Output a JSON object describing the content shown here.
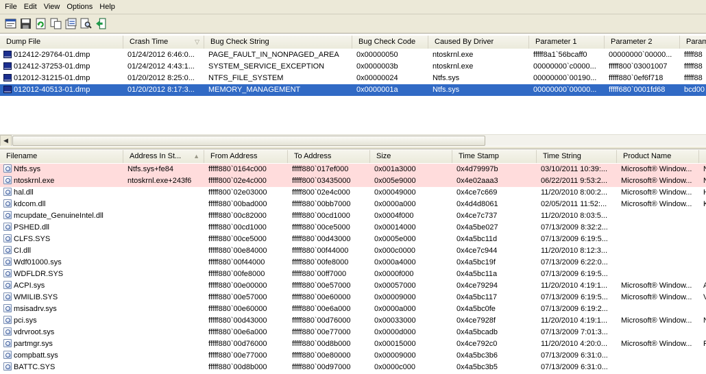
{
  "menu": [
    "File",
    "Edit",
    "View",
    "Options",
    "Help"
  ],
  "toolbar": [
    "properties-icon",
    "save-icon",
    "refresh-icon",
    "copy-icon",
    "report-icon",
    "find-icon",
    "exit-icon"
  ],
  "dumps": {
    "columns": [
      {
        "label": "Dump File"
      },
      {
        "label": "Crash Time",
        "sort": "▽"
      },
      {
        "label": "Bug Check String"
      },
      {
        "label": "Bug Check Code"
      },
      {
        "label": "Caused By Driver"
      },
      {
        "label": "Parameter 1"
      },
      {
        "label": "Parameter 2"
      },
      {
        "label": "Param"
      }
    ],
    "rows": [
      {
        "c": [
          "012412-29764-01.dmp",
          "01/24/2012 6:46:0...",
          "PAGE_FAULT_IN_NONPAGED_AREA",
          "0x00000050",
          "ntoskrnl.exe",
          "fffff8a1`56bcaff0",
          "00000000`00000...",
          "fffff88"
        ],
        "selected": false
      },
      {
        "c": [
          "012412-37253-01.dmp",
          "01/24/2012 4:43:1...",
          "SYSTEM_SERVICE_EXCEPTION",
          "0x0000003b",
          "ntoskrnl.exe",
          "00000000`c0000...",
          "fffff800`03001007",
          "fffff88"
        ],
        "selected": false
      },
      {
        "c": [
          "012012-31215-01.dmp",
          "01/20/2012 8:25:0...",
          "NTFS_FILE_SYSTEM",
          "0x00000024",
          "Ntfs.sys",
          "00000000`00190...",
          "fffff880`0ef6f718",
          "fffff88"
        ],
        "selected": false
      },
      {
        "c": [
          "012012-40513-01.dmp",
          "01/20/2012 8:17:3...",
          "MEMORY_MANAGEMENT",
          "0x0000001a",
          "Ntfs.sys",
          "00000000`00000...",
          "fffff680`0001fd68",
          "bcd00"
        ],
        "selected": true
      }
    ]
  },
  "modules": {
    "columns": [
      {
        "label": "Filename"
      },
      {
        "label": "Address In St...",
        "sort": "▲"
      },
      {
        "label": "From Address"
      },
      {
        "label": "To Address"
      },
      {
        "label": "Size"
      },
      {
        "label": "Time Stamp"
      },
      {
        "label": "Time String"
      },
      {
        "label": "Product Name"
      },
      {
        "label": ""
      }
    ],
    "rows": [
      {
        "c": [
          "Ntfs.sys",
          "Ntfs.sys+fe84",
          "fffff880`0164c000",
          "fffff880`017ef000",
          "0x001a3000",
          "0x4d79997b",
          "03/10/2011 10:39:...",
          "Microsoft® Window...",
          "N"
        ],
        "highlight": true
      },
      {
        "c": [
          "ntoskrnl.exe",
          "ntoskrnl.exe+243f6",
          "fffff800`02e4c000",
          "fffff800`03435000",
          "0x005e9000",
          "0x4e02aaa3",
          "06/22/2011 9:53:2...",
          "Microsoft® Window...",
          "N"
        ],
        "highlight": true
      },
      {
        "c": [
          "hal.dll",
          "",
          "fffff800`02e03000",
          "fffff800`02e4c000",
          "0x00049000",
          "0x4ce7c669",
          "11/20/2010 8:00:2...",
          "Microsoft® Window...",
          "H"
        ],
        "highlight": false
      },
      {
        "c": [
          "kdcom.dll",
          "",
          "fffff880`00bad000",
          "fffff880`00bb7000",
          "0x0000a000",
          "0x4d4d8061",
          "02/05/2011 11:52:...",
          "Microsoft® Window...",
          "K"
        ],
        "highlight": false
      },
      {
        "c": [
          "mcupdate_GenuineIntel.dll",
          "",
          "fffff880`00c82000",
          "fffff880`00cd1000",
          "0x0004f000",
          "0x4ce7c737",
          "11/20/2010 8:03:5...",
          "",
          ""
        ],
        "highlight": false
      },
      {
        "c": [
          "PSHED.dll",
          "",
          "fffff880`00cd1000",
          "fffff880`00ce5000",
          "0x00014000",
          "0x4a5be027",
          "07/13/2009 8:32:2...",
          "",
          ""
        ],
        "highlight": false
      },
      {
        "c": [
          "CLFS.SYS",
          "",
          "fffff880`00ce5000",
          "fffff880`00d43000",
          "0x0005e000",
          "0x4a5bc11d",
          "07/13/2009 6:19:5...",
          "",
          ""
        ],
        "highlight": false
      },
      {
        "c": [
          "CI.dll",
          "",
          "fffff880`00e84000",
          "fffff880`00f44000",
          "0x000c0000",
          "0x4ce7c944",
          "11/20/2010 8:12:3...",
          "",
          ""
        ],
        "highlight": false
      },
      {
        "c": [
          "Wdf01000.sys",
          "",
          "fffff880`00f44000",
          "fffff880`00fe8000",
          "0x000a4000",
          "0x4a5bc19f",
          "07/13/2009 6:22:0...",
          "",
          ""
        ],
        "highlight": false
      },
      {
        "c": [
          "WDFLDR.SYS",
          "",
          "fffff880`00fe8000",
          "fffff880`00ff7000",
          "0x0000f000",
          "0x4a5bc11a",
          "07/13/2009 6:19:5...",
          "",
          ""
        ],
        "highlight": false
      },
      {
        "c": [
          "ACPI.sys",
          "",
          "fffff880`00e00000",
          "fffff880`00e57000",
          "0x00057000",
          "0x4ce79294",
          "11/20/2010 4:19:1...",
          "Microsoft® Window...",
          "A"
        ],
        "highlight": false
      },
      {
        "c": [
          "WMILIB.SYS",
          "",
          "fffff880`00e57000",
          "fffff880`00e60000",
          "0x00009000",
          "0x4a5bc117",
          "07/13/2009 6:19:5...",
          "Microsoft® Window...",
          "V"
        ],
        "highlight": false
      },
      {
        "c": [
          "msisadrv.sys",
          "",
          "fffff880`00e60000",
          "fffff880`00e6a000",
          "0x0000a000",
          "0x4a5bc0fe",
          "07/13/2009 6:19:2...",
          "",
          ""
        ],
        "highlight": false
      },
      {
        "c": [
          "pci.sys",
          "",
          "fffff880`00d43000",
          "fffff880`00d76000",
          "0x00033000",
          "0x4ce7928f",
          "11/20/2010 4:19:1...",
          "Microsoft® Window...",
          "N"
        ],
        "highlight": false
      },
      {
        "c": [
          "vdrvroot.sys",
          "",
          "fffff880`00e6a000",
          "fffff880`00e77000",
          "0x0000d000",
          "0x4a5bcadb",
          "07/13/2009 7:01:3...",
          "",
          ""
        ],
        "highlight": false
      },
      {
        "c": [
          "partmgr.sys",
          "",
          "fffff880`00d76000",
          "fffff880`00d8b000",
          "0x00015000",
          "0x4ce792c0",
          "11/20/2010 4:20:0...",
          "Microsoft® Window...",
          "P"
        ],
        "highlight": false
      },
      {
        "c": [
          "compbatt.sys",
          "",
          "fffff880`00e77000",
          "fffff880`00e80000",
          "0x00009000",
          "0x4a5bc3b6",
          "07/13/2009 6:31:0...",
          "",
          ""
        ],
        "highlight": false
      },
      {
        "c": [
          "BATTC.SYS",
          "",
          "fffff880`00d8b000",
          "fffff880`00d97000",
          "0x0000c000",
          "0x4a5bc3b5",
          "07/13/2009 6:31:0...",
          "",
          ""
        ],
        "highlight": false
      }
    ]
  }
}
